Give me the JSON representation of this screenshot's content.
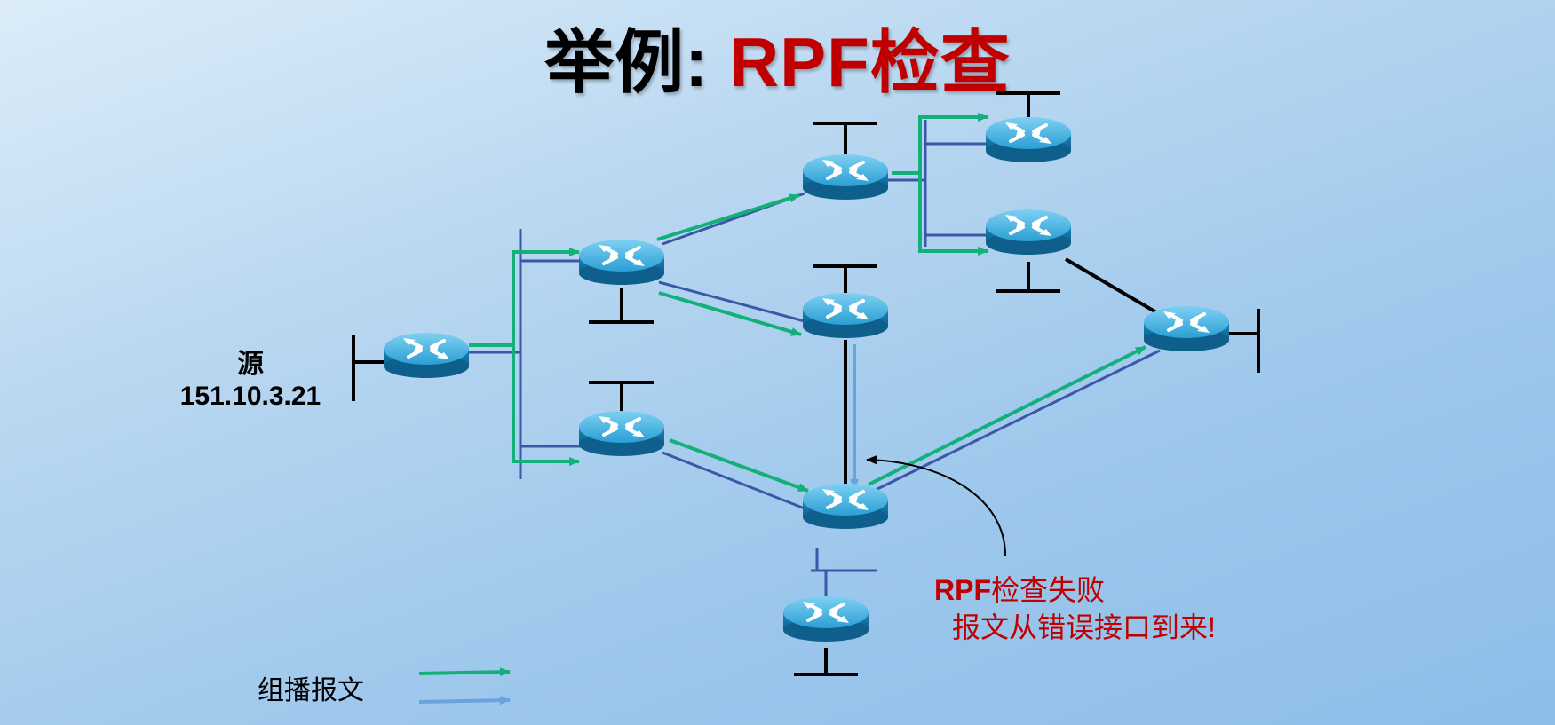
{
  "title": {
    "prefix": "举例: ",
    "highlight": "RPF检查"
  },
  "source": {
    "label": "源",
    "ip": "151.10.3.21"
  },
  "annotation": {
    "line1_prefix": "RPF",
    "line1_rest": "检查失败",
    "line2": "报文从错误接口到来!"
  },
  "legend": {
    "label": "组播报文"
  },
  "colors": {
    "multicast_arrow": "#13b07a",
    "failed_arrow": "#6aa3dc",
    "link": "#3c57a8",
    "annotation_red": "#c00000",
    "router_body": "#1f8fc4"
  },
  "icons": {
    "router": "router-icon"
  }
}
